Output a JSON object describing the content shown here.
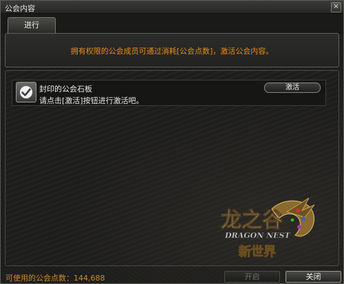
{
  "window": {
    "title": "公会内容",
    "close_glyph": "×"
  },
  "tabs": [
    {
      "label": "进行"
    }
  ],
  "info": {
    "text": "拥有权限的公会成员可通过消耗[公会点数]，激活公会内容。"
  },
  "items": [
    {
      "icon": "checkmark-icon",
      "name": "封印的公会石板",
      "description": "请点击[激活]按钮进行激活吧。",
      "action_label": "激活"
    }
  ],
  "footer": {
    "points_label": "可使用的公会点数：",
    "points_value": "144,688",
    "open_label": "开启",
    "close_label": "关闭"
  },
  "logo": {
    "title": "龙之谷",
    "subtitle": "DRAGON NEST",
    "tagline": "新世界"
  },
  "colors": {
    "accent_orange": "#e88a1c",
    "footer_orange": "#d08a2a",
    "logo_gold": "#c9a24a"
  }
}
